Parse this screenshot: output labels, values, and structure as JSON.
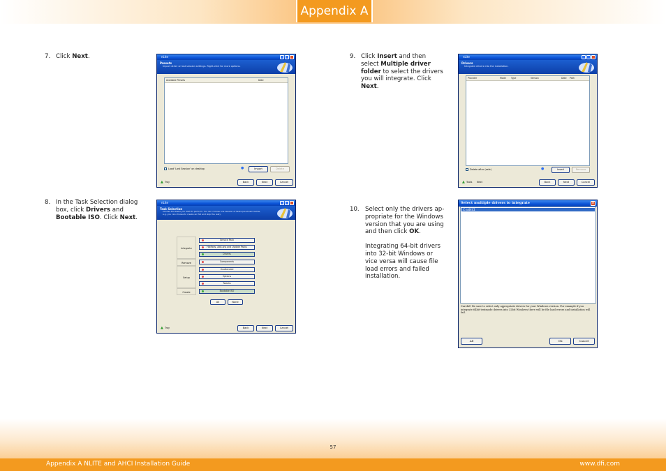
{
  "header": {
    "title": "Appendix A"
  },
  "steps": [
    {
      "num": "7.",
      "parts": [
        "Click ",
        "Next",
        "."
      ]
    },
    {
      "num": "8.",
      "line1": "In the Task Selection dialog",
      "line2": "box, click ",
      "drivers": "Drivers",
      "and": " and",
      "bootable": "Bootable ISO",
      "mid": ". Click ",
      "next": "Next",
      "end": "."
    },
    {
      "num": "9.",
      "l1a": "Click ",
      "insert": "Insert",
      "l1b": " and then",
      "l2": "select ",
      "multi1": "Multiple driver",
      "multi2": "folder",
      "l3b": " to select the drivers",
      "l4": "you will integrate. Click",
      "next": "Next",
      "end": "."
    },
    {
      "num": "10.",
      "lines": [
        "Select only the drivers ap-",
        "propriate for the Windows",
        "version that you are using",
        "and then click "
      ],
      "ok": "OK",
      "end": ".",
      "note": [
        "Integrating 64-bit drivers",
        "into 32-bit Windows or",
        "vice versa will cause file",
        "load errors and failed",
        "installation."
      ]
    }
  ],
  "dialog_presets": {
    "window_title": "nLite",
    "banner_title": "Presets",
    "banner_subtitle": "Import other or last session settings. Right-click for more options.",
    "col_available": "Available Presets",
    "col_date": "Date",
    "checkbox_label": "Load 'Last Session' on desktop",
    "import": "Import",
    "delete": "Delete",
    "tray": "Tray",
    "back": "Back",
    "next": "Next",
    "cancel": "Cancel"
  },
  "dialog_drivers": {
    "window_title": "nLite",
    "banner_title": "Drivers",
    "banner_subtitle": "Integrate drivers into the installation.",
    "cols": [
      "Provider",
      "Mode",
      "Type",
      "Version",
      "Date",
      "Path"
    ],
    "checkbox_label": "Delete after (safe)",
    "insert": "Insert",
    "remove": "Remove",
    "tray": "Tools",
    "next_label": "Next",
    "back": "Back",
    "next": "Next",
    "cancel": "Cancel"
  },
  "dialog_tasks": {
    "window_title": "nLite",
    "banner_title": "Task Selection",
    "banner_subtitle": "Choose the tasks you wish to perform. You can choose one session of tasks (as shown below, e.g. you can choose to create an ISO and skip the rest).",
    "groups": {
      "integrate": "Integrate",
      "remove": "Remove",
      "setup": "Setup",
      "create": "Create"
    },
    "tasks": [
      {
        "label": "Service Pack",
        "on": false
      },
      {
        "label": "Hotfixes, Add-ons and Update Packs",
        "on": false
      },
      {
        "label": "Drivers",
        "on": true
      },
      {
        "label": "Components",
        "on": false
      },
      {
        "label": "Unattended",
        "on": false
      },
      {
        "label": "Options",
        "on": false
      },
      {
        "label": "Tweaks",
        "on": false
      },
      {
        "label": "Bootable ISO",
        "on": true
      }
    ],
    "all": "All",
    "none": "None",
    "tray": "Tray",
    "back": "Back",
    "next": "Next",
    "cancel": "Cancel"
  },
  "dialog_select": {
    "title": "Select multiple drivers to integrate",
    "item": "C:\\AHCI",
    "warning": "Careful! Be sure to select only appropriate drivers for your Windows version. For example if you integrate 64bit textmode drivers into 32bit Windows there will be file load errors and installation will fail.",
    "all": "All",
    "ok": "OK",
    "cancel": "Cancel"
  },
  "page_number": "57",
  "footer": {
    "left": "Appendix A NLITE and AHCI Installation Guide",
    "right": "www.dfi.com"
  }
}
